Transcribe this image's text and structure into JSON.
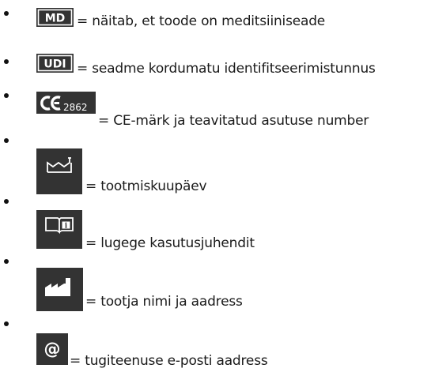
{
  "symbols": [
    {
      "icon": "md-icon",
      "icon_text": "MD",
      "text": "= näitab, et toode on meditsiiniseade"
    },
    {
      "icon": "udi-icon",
      "icon_text": "UDI",
      "text": "= seadme kordumatu identifitseerimistunnus"
    },
    {
      "icon": "ce-mark-icon",
      "icon_text": "CE 2862",
      "text": "= CE-märk ja teavitatud asutuse number"
    },
    {
      "icon": "date-of-manufacture-icon",
      "text": "= tootmiskuupäev"
    },
    {
      "icon": "instructions-for-use-icon",
      "text": "= lugege kasutusjuhendit"
    },
    {
      "icon": "manufacturer-icon",
      "text": "= tootja nimi ja aadress"
    },
    {
      "icon": "email-icon",
      "icon_text": "@",
      "text": "= tugiteenuse e-posti aadress"
    }
  ],
  "colors": {
    "icon_background": "#333333",
    "icon_foreground": "#ffffff",
    "text": "#1a1a1a"
  }
}
